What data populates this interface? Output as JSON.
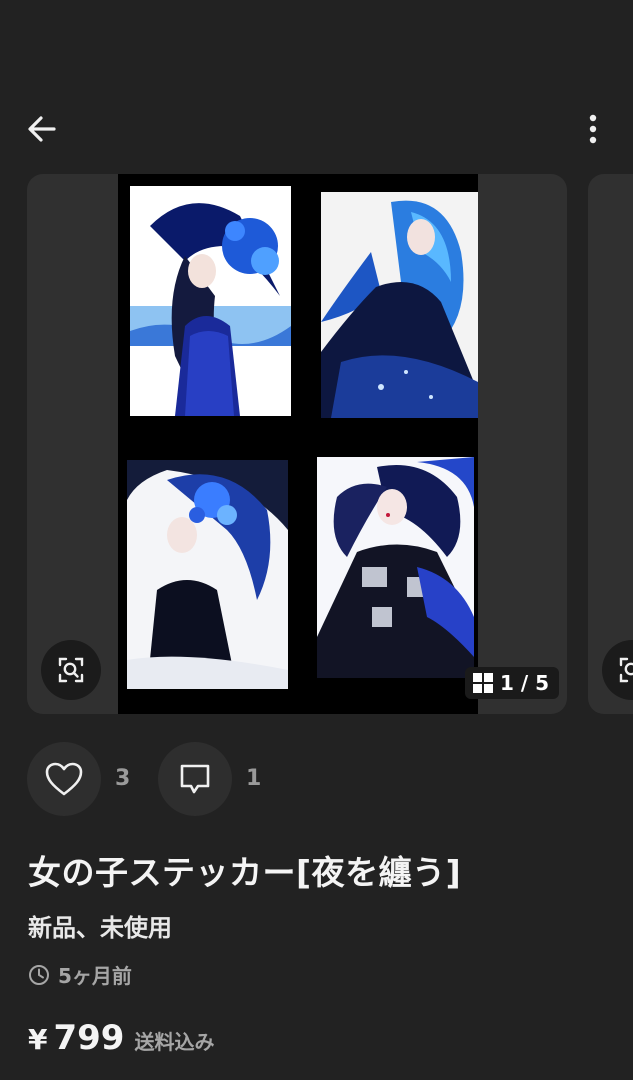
{
  "header": {
    "back_icon": "arrow-left-icon",
    "menu_icon": "more-vertical-icon"
  },
  "gallery": {
    "counter": "1 / 5",
    "counter_icon": "grid-icon",
    "zoom_icon": "search-image-icon"
  },
  "actions": {
    "like_icon": "heart-icon",
    "like_count": "3",
    "comment_icon": "comment-icon",
    "comment_count": "1"
  },
  "item": {
    "title": "女の子ステッカー[夜を纏う]",
    "condition": "新品、未使用",
    "posted_icon": "clock-icon",
    "posted": "5ヶ月前",
    "currency": "¥",
    "price": "799",
    "shipping": "送料込み"
  },
  "colors": {
    "background": "#222222",
    "card": "#303030",
    "muted_text": "#a6a6a6",
    "accent_blue": "#1e63ff"
  }
}
